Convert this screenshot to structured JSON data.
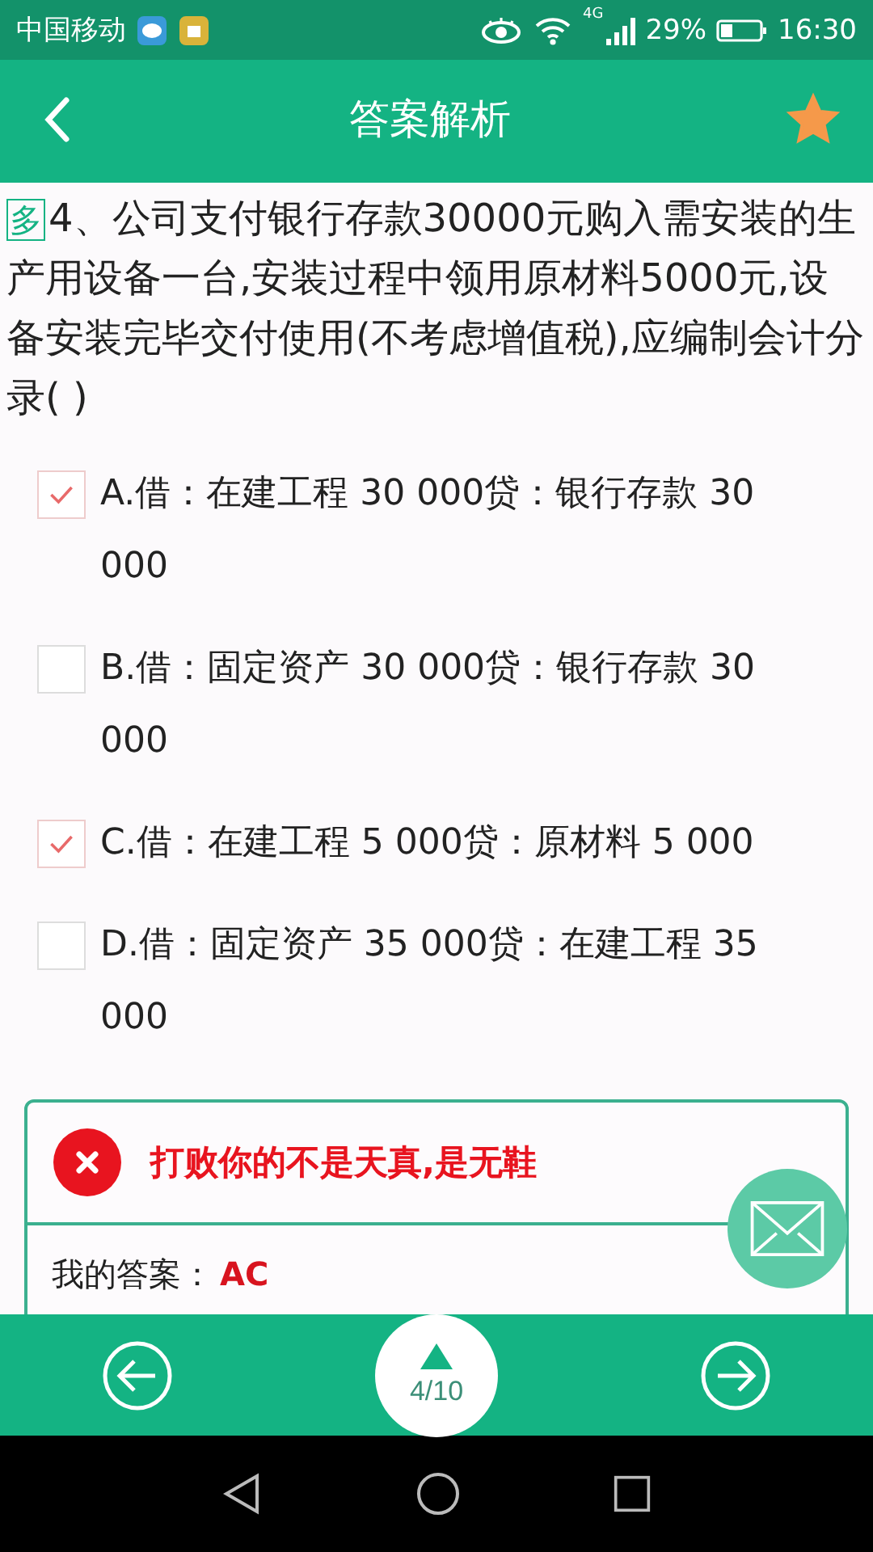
{
  "status_bar": {
    "carrier": "中国移动",
    "network": "4G",
    "battery": "29%",
    "time": "16:30"
  },
  "header": {
    "title": "答案解析",
    "starred": true
  },
  "question": {
    "type_badge": "多",
    "text": "4、公司支付银行存款30000元购入需安装的生产用设备一台,安装过程中领用原材料5000元,设备安装完毕交付使用(不考虑增值税),应编制会计分录( )"
  },
  "options": [
    {
      "text": "A.借：在建工程 30 000贷：银行存款 30 000",
      "checked": true
    },
    {
      "text": "B.借：固定资产 30 000贷：银行存款 30 000",
      "checked": false
    },
    {
      "text": "C.借：在建工程 5 000贷：原材料 5 000",
      "checked": true
    },
    {
      "text": "D.借：固定资产 35 000贷：在建工程 35 000",
      "checked": false
    }
  ],
  "result": {
    "correct": false,
    "message": "打败你的不是天真,是无鞋",
    "my_answer_label": "我的答案：",
    "my_answer": "AC"
  },
  "footer": {
    "page": "4/10"
  }
}
